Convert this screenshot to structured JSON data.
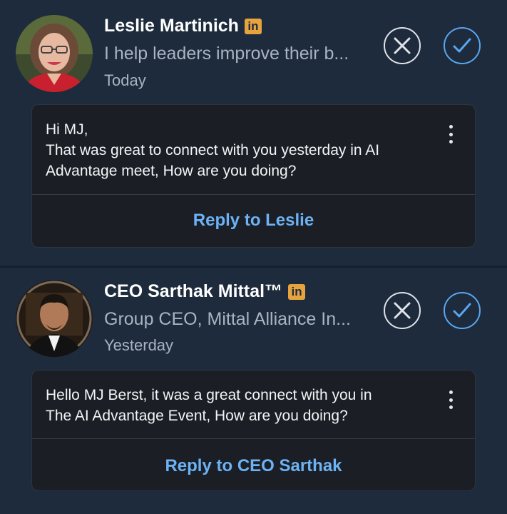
{
  "invitations": [
    {
      "name": "Leslie Martinich",
      "badge": "in",
      "headline": "I help leaders improve their b...",
      "time": "Today",
      "message_lines": [
        "Hi MJ,",
        "That was great to connect with you yesterday in AI",
        "Advantage meet, How are you doing?"
      ],
      "reply_label": "Reply to Leslie"
    },
    {
      "name": "CEO Sarthak Mittal™",
      "badge": "in",
      "headline": "Group CEO, Mittal Alliance In...",
      "time": "Yesterday",
      "message_lines": [
        "Hello MJ Berst, it was a great connect with you in",
        "The AI Advantage Event, How are you doing?"
      ],
      "reply_label": "Reply to CEO Sarthak"
    }
  ],
  "icons": {
    "badge": "linkedin-icon",
    "ignore": "close-circle-icon",
    "accept": "check-circle-icon",
    "more": "more-vertical-icon"
  },
  "colors": {
    "background": "#1d2b3c",
    "card": "#1b1f25",
    "accent": "#5aa6f0",
    "reply": "#6cb2f5",
    "badge": "#e7a33e",
    "secondary_text": "#a9b4c1"
  }
}
